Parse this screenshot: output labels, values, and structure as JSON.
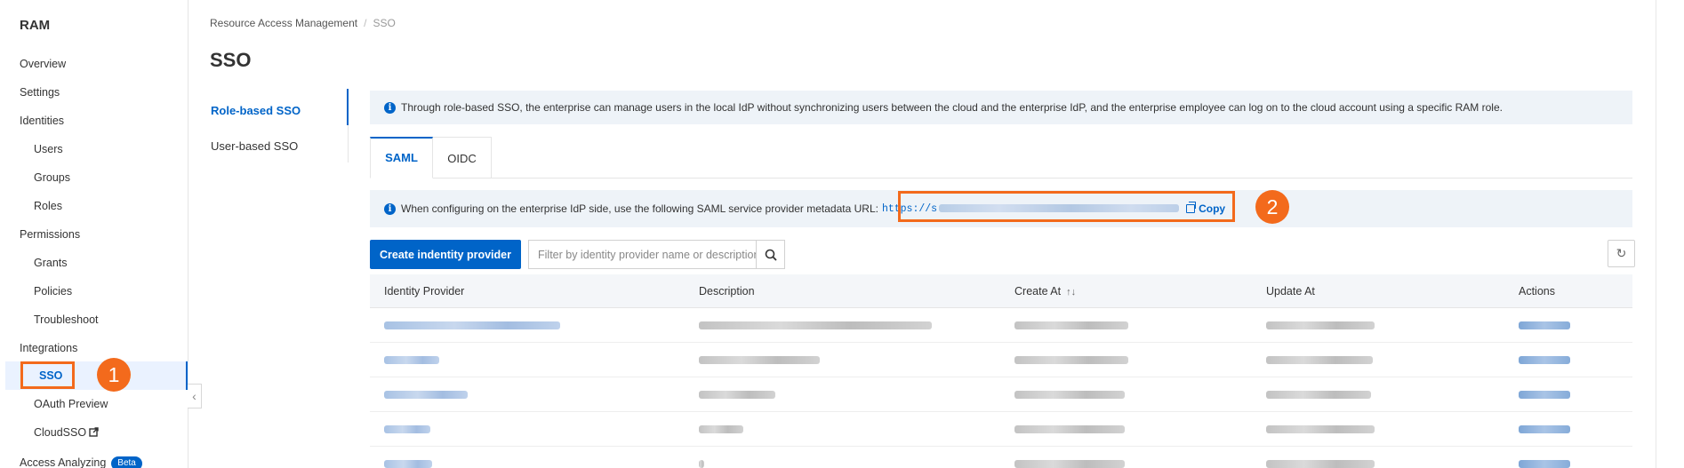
{
  "sidebar": {
    "title": "RAM",
    "items": [
      {
        "label": "Overview"
      },
      {
        "label": "Settings"
      },
      {
        "label": "Identities"
      },
      {
        "label": "Users"
      },
      {
        "label": "Groups"
      },
      {
        "label": "Roles"
      },
      {
        "label": "Permissions"
      },
      {
        "label": "Grants"
      },
      {
        "label": "Policies"
      },
      {
        "label": "Troubleshoot"
      },
      {
        "label": "Integrations"
      },
      {
        "label": "SSO"
      },
      {
        "label": "OAuth Preview"
      },
      {
        "label": "CloudSSO"
      },
      {
        "label": "Access Analyzing"
      }
    ],
    "beta_badge": "Beta",
    "active_item": "SSO"
  },
  "breadcrumb": {
    "root": "Resource Access Management",
    "separator": "/",
    "current": "SSO"
  },
  "page_title": "SSO",
  "subnav": {
    "items": [
      {
        "label": "Role-based SSO",
        "active": true
      },
      {
        "label": "User-based SSO",
        "active": false
      }
    ]
  },
  "info_banner": "Through role-based SSO, the enterprise can manage users in the local IdP without synchronizing users between the cloud and the enterprise IdP, and the enterprise employee can log on to the cloud account using a specific RAM role.",
  "tabs": [
    {
      "label": "SAML",
      "active": true
    },
    {
      "label": "OIDC",
      "active": false
    }
  ],
  "metadata": {
    "text": "When configuring on the enterprise IdP side, use the following SAML service provider metadata URL:",
    "url_prefix": "https://s",
    "copy_label": "Copy"
  },
  "toolbar": {
    "create_label": "Create indentity provider",
    "search_placeholder": "Filter by identity provider name or description"
  },
  "table": {
    "columns": [
      "Identity Provider",
      "Description",
      "Create At",
      "Update At",
      "Actions"
    ]
  },
  "annotations": [
    "1",
    "2"
  ],
  "colors": {
    "accent": "#0064c8",
    "annotation": "#f36a1c",
    "banner_bg": "#eef3f8"
  },
  "icons": [
    "info-icon",
    "search-icon",
    "refresh-icon",
    "copy-icon",
    "external-link-icon",
    "chevron-left-icon",
    "sort-icon"
  ]
}
